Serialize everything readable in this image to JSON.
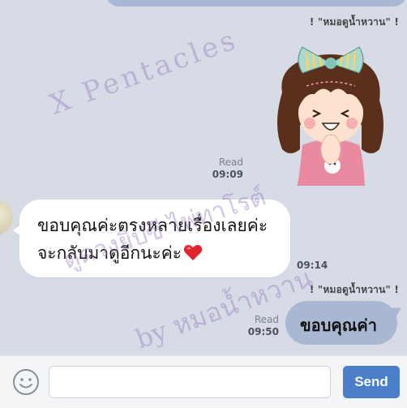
{
  "chat": {
    "sender_name_1": "! \"หมอดูน้ำหวาน\" !",
    "sender_name_2": "! \"หมอดูน้ำหวาน\" !",
    "sticker": {
      "icon": "girl-cheering-sticker"
    },
    "sticker_meta": {
      "read": "Read",
      "time": "09:09"
    },
    "incoming": {
      "line1": "ขอบคุณค่ะตรงหลายเรื่องเลยค่ะ",
      "line2": "จะกลับมาดูอีกนะค่ะ",
      "emoji": "heart-icon",
      "time": "09:14"
    },
    "outgoing": {
      "text": "ขอบคุณค่า",
      "read": "Read",
      "time": "09:50"
    }
  },
  "watermarks": {
    "line1": "X Pentacles",
    "line2": "ดูดวงยิปซี ไพ่ทาโรต์",
    "line3": "by หมอน้ำหวาน"
  },
  "inputbar": {
    "emoji_icon": "smiley-icon",
    "placeholder": "",
    "send_label": "Send"
  },
  "colors": {
    "background": "#d6dbe5",
    "outgoing_bubble": "#a9b8d2",
    "incoming_bubble": "#ffffff",
    "send_button": "#4a7ec9"
  }
}
